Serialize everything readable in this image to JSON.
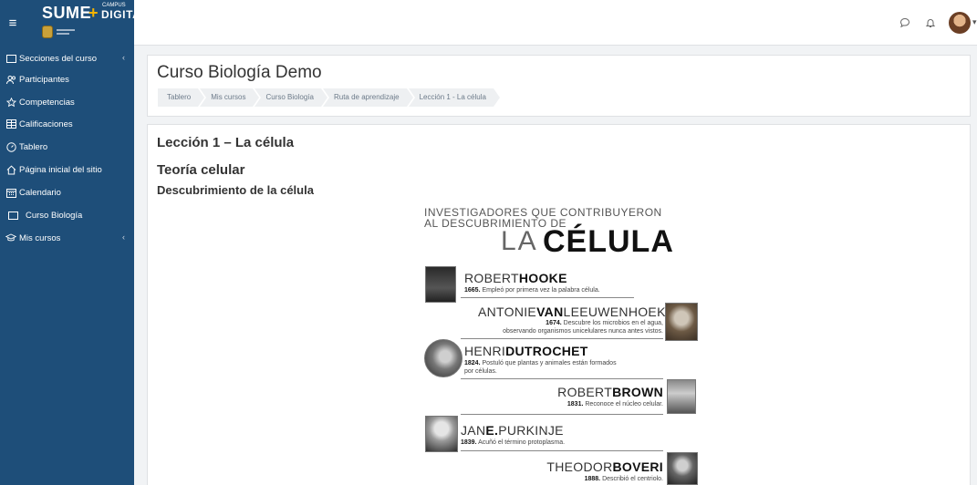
{
  "brand": {
    "word": "SUME",
    "plus": "+",
    "campus": "CAMPUS",
    "digital": "DIGITAL"
  },
  "navbar": {
    "menu_icon": "hamburger-icon",
    "message_icon": "chat-bubble-icon",
    "notification_icon": "bell-icon",
    "caret": "▾"
  },
  "sidebar": {
    "items": [
      {
        "label": "Secciones del curso",
        "icon": "folder-icon",
        "chevron": "‹"
      },
      {
        "label": "Participantes",
        "icon": "users-icon"
      },
      {
        "label": "Competencias",
        "icon": "star-icon"
      },
      {
        "label": "Calificaciones",
        "icon": "grades-icon"
      },
      {
        "label": "Tablero",
        "icon": "dashboard-icon"
      },
      {
        "label": "Página inicial del sitio",
        "icon": "home-icon"
      },
      {
        "label": "Calendario",
        "icon": "calendar-icon"
      },
      {
        "label": "Curso Biología",
        "icon": "folder-icon"
      },
      {
        "label": "Mis cursos",
        "icon": "graduation-cap-icon",
        "chevron": "‹"
      }
    ]
  },
  "header": {
    "title": "Curso Biología Demo",
    "breadcrumb": [
      "Tablero",
      "Mis cursos",
      "Curso Biología",
      "Ruta de aprendizaje",
      "Lección 1 - La célula"
    ]
  },
  "content": {
    "lesson_title": "Lección 1 – La célula",
    "section_title": "Teoría celular",
    "subsection_title": "Descubrimiento de la célula"
  },
  "infographic": {
    "heading_line1": "INVESTIGADORES QUE CONTRIBUYERON",
    "heading_line2": "AL DESCUBRIMIENTO DE",
    "heading_la": "LA",
    "heading_celula": "CÉLULA",
    "researchers": [
      {
        "first": "ROBERT",
        "last": "HOOKE",
        "year": "1665.",
        "desc": "Empleó por primera vez la palabra célula."
      },
      {
        "first": "ANTONIE",
        "last": "VAN",
        "rest": "LEEUWENHOEK",
        "year": "1674.",
        "desc": "Descubre los microbios en el agua,",
        "desc2": "observando organismos unicelulares nunca antes vistos."
      },
      {
        "first": "HENRI",
        "last": "DUTROCHET",
        "year": "1824.",
        "desc": "Postuló que plantas y animales están formados",
        "desc2": "por células."
      },
      {
        "first": "ROBERT",
        "last": "BROWN",
        "year": "1831.",
        "desc": "Reconoce el núcleo celular."
      },
      {
        "first": "JAN",
        "last": "E.",
        "rest": "PURKINJE",
        "year": "1839.",
        "desc": "Acuñó el término protoplasma."
      },
      {
        "first": "THEODOR",
        "last": "BOVERI",
        "year": "1888.",
        "desc": "Describió el centriolo."
      }
    ]
  },
  "colors": {
    "sidebar": "#1e4e79",
    "accent": "#f5b400",
    "page_bg": "#f1f3f5"
  }
}
